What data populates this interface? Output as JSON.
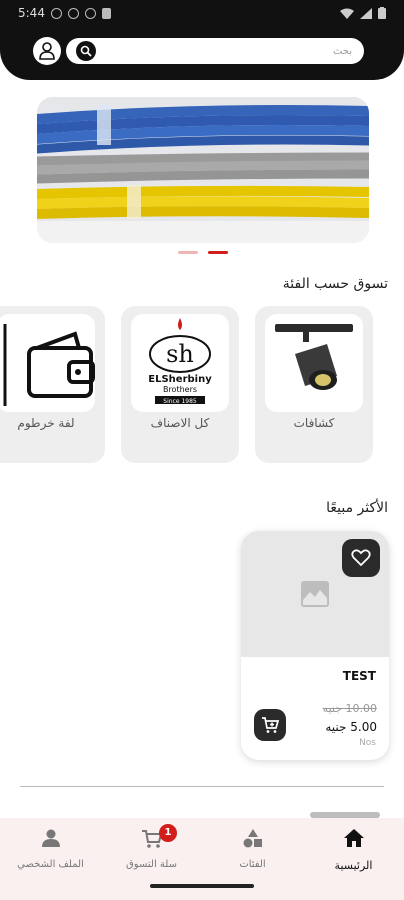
{
  "status_bar": {
    "time": "5:44"
  },
  "header": {
    "search": {
      "placeholder": "بحث"
    }
  },
  "banner": {
    "slide_count": 2,
    "active_slide": 2
  },
  "categories_section": {
    "title": "تسوق حسب الفئة",
    "items": [
      {
        "label": "كشافات",
        "icon": "spotlight-image"
      },
      {
        "label": "كل الاصناف",
        "icon": "elsherbiny-logo",
        "logo_text": [
          "ELSherbiny",
          "Brothers",
          "Since 1985"
        ]
      },
      {
        "label": "لفة خرطوم",
        "icon": "wallet-icon"
      }
    ]
  },
  "bestsellers_section": {
    "title": "الأكثر مبيعًا",
    "products": [
      {
        "name": "TEST",
        "old_price": "10.00 جنيه",
        "new_price": "5.00 جنيه",
        "unit": "Nos"
      }
    ]
  },
  "bottom_nav": {
    "items": [
      {
        "label": "الرئيسية",
        "icon": "home-icon",
        "active": true
      },
      {
        "label": "الفئات",
        "icon": "categories-icon",
        "active": false
      },
      {
        "label": "سلة التسوق",
        "icon": "cart-icon",
        "active": false,
        "badge": "1"
      },
      {
        "label": "الملف الشخصي",
        "icon": "profile-icon",
        "active": false
      }
    ]
  },
  "colors": {
    "accent": "#d21d1d",
    "header_bg": "#111111",
    "nav_bg": "#fbf0f0"
  }
}
